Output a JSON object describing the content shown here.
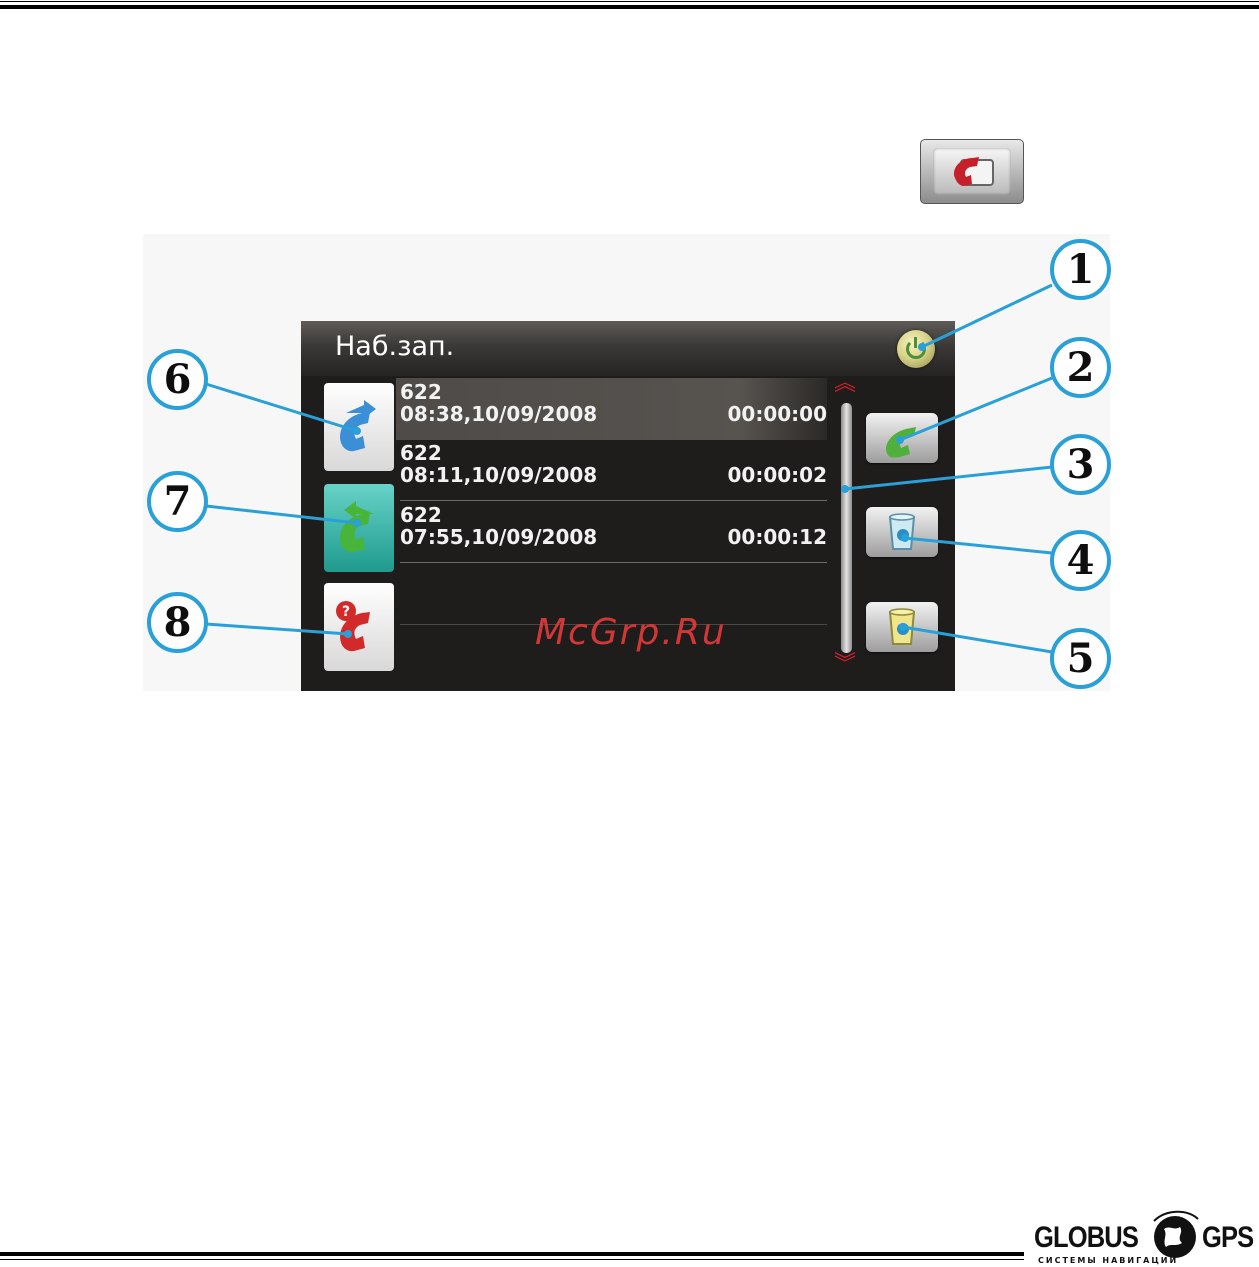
{
  "screen": {
    "title": "Наб.зап.",
    "entries": [
      {
        "number": "622",
        "datetime": "08:38,10/09/2008",
        "duration": "00:00:00"
      },
      {
        "number": "622",
        "datetime": "08:11,10/09/2008",
        "duration": "00:00:02"
      },
      {
        "number": "622",
        "datetime": "07:55,10/09/2008",
        "duration": "00:00:12"
      }
    ]
  },
  "callouts": [
    "1",
    "2",
    "3",
    "4",
    "5",
    "6",
    "7",
    "8"
  ],
  "watermark": "McGrp.Ru",
  "logo": {
    "left": "GLOBUS",
    "right": "GPS",
    "subtitle": "СИСТЕМЫ НАВИГАЦИИ"
  },
  "icons": {
    "top": "phone-log-icon",
    "power": "power-icon",
    "call": "call-icon",
    "delete": "trash-icon",
    "delete_all": "trash-all-icon",
    "dialed": "dialed-call-icon",
    "received": "received-call-icon",
    "missed": "missed-call-icon"
  },
  "colors": {
    "accent": "#2aa0d8",
    "danger": "#d5202a",
    "screen_bg": "#1f1d1c"
  }
}
